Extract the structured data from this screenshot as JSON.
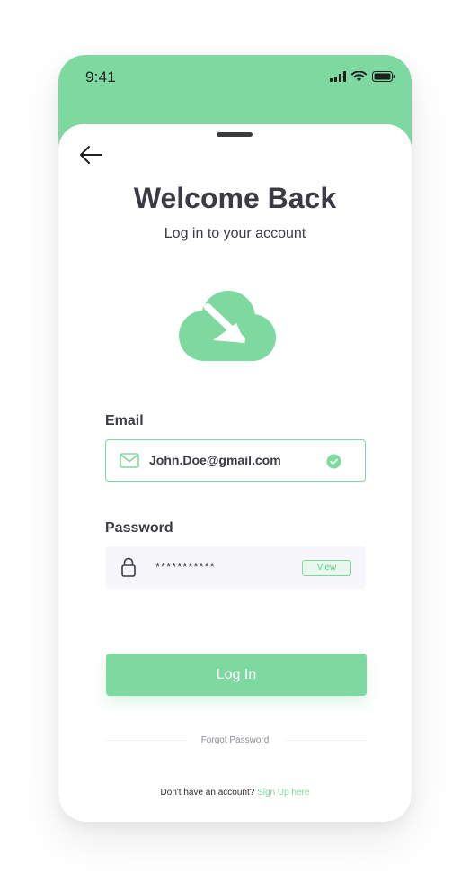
{
  "status_bar": {
    "time": "9:41"
  },
  "header": {
    "title": "Welcome Back",
    "subtitle": "Log in to your account"
  },
  "form": {
    "email_label": "Email",
    "email_value": "John.Doe@gmail.com",
    "password_label": "Password",
    "password_value": "***********",
    "view_label": "View",
    "login_label": "Log In",
    "forgot_label": "Forgot Password"
  },
  "footer": {
    "prompt": "Don't have an account?",
    "signup_label": "Sign Up here"
  },
  "colors": {
    "accent": "#7ED9A0",
    "text": "#3b3b44",
    "field_bg": "#F7F7FB"
  },
  "icons": {
    "back": "arrow-left-icon",
    "logo": "cloud-download-logo",
    "email": "mail-icon",
    "email_status": "check-circle-icon",
    "password": "lock-icon",
    "signal": "signal-icon",
    "wifi": "wifi-icon",
    "battery": "battery-icon"
  }
}
